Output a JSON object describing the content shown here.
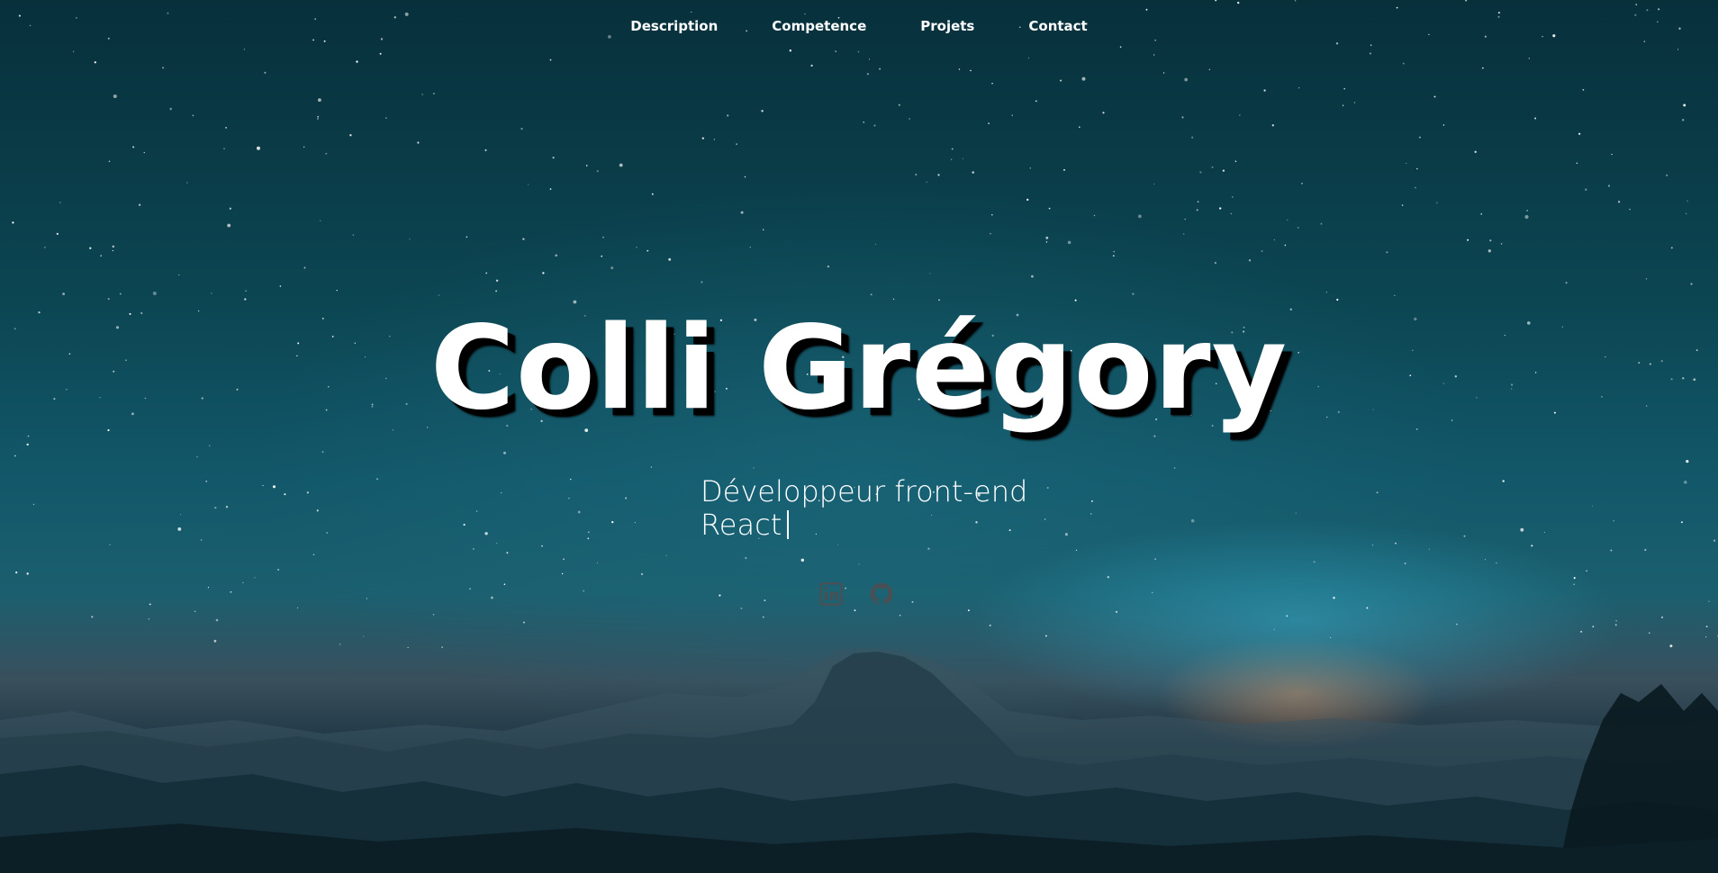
{
  "nav": {
    "items": [
      {
        "label": "Description"
      },
      {
        "label": "Competence"
      },
      {
        "label": "Projets"
      },
      {
        "label": "Contact"
      }
    ]
  },
  "hero": {
    "title": "Colli Grégory",
    "subtitle_line1": "Développeur front-end",
    "subtitle_line2": "React"
  },
  "socials": [
    {
      "icon": "linkedin-icon"
    },
    {
      "icon": "github-icon"
    }
  ],
  "colors": {
    "text": "#ffffff",
    "title_shadow": "#000000",
    "social_icon": "#4a4f54",
    "sky_top": "#07303b",
    "sky_glow": "#32aac8",
    "horizon_glow": "#dc8c5a"
  }
}
